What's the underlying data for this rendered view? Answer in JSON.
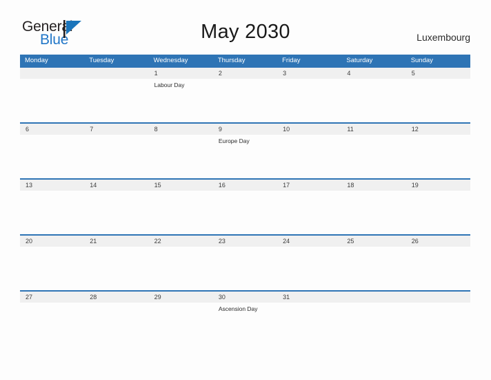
{
  "brand": {
    "name_top": "General",
    "name_bottom": "Blue",
    "mark": "flag-triangle-icon",
    "color_top": "#231f20",
    "color_bottom": "#2277c8",
    "mark_color": "#1b75bb"
  },
  "header": {
    "title": "May 2030",
    "country": "Luxembourg"
  },
  "theme": {
    "accent": "#2e74b5",
    "band": "#f0f0f0",
    "page_background": "#fdfdfd"
  },
  "calendar": {
    "day_headers": [
      "Monday",
      "Tuesday",
      "Wednesday",
      "Thursday",
      "Friday",
      "Saturday",
      "Sunday"
    ],
    "weeks": [
      {
        "dates": [
          "",
          "",
          "1",
          "2",
          "3",
          "4",
          "5"
        ],
        "events": [
          "",
          "",
          "Labour Day",
          "",
          "",
          "",
          ""
        ]
      },
      {
        "dates": [
          "6",
          "7",
          "8",
          "9",
          "10",
          "11",
          "12"
        ],
        "events": [
          "",
          "",
          "",
          "Europe Day",
          "",
          "",
          ""
        ]
      },
      {
        "dates": [
          "13",
          "14",
          "15",
          "16",
          "17",
          "18",
          "19"
        ],
        "events": [
          "",
          "",
          "",
          "",
          "",
          "",
          ""
        ]
      },
      {
        "dates": [
          "20",
          "21",
          "22",
          "23",
          "24",
          "25",
          "26"
        ],
        "events": [
          "",
          "",
          "",
          "",
          "",
          "",
          ""
        ]
      },
      {
        "dates": [
          "27",
          "28",
          "29",
          "30",
          "31",
          "",
          ""
        ],
        "events": [
          "",
          "",
          "",
          "Ascension Day",
          "",
          "",
          ""
        ]
      }
    ]
  }
}
